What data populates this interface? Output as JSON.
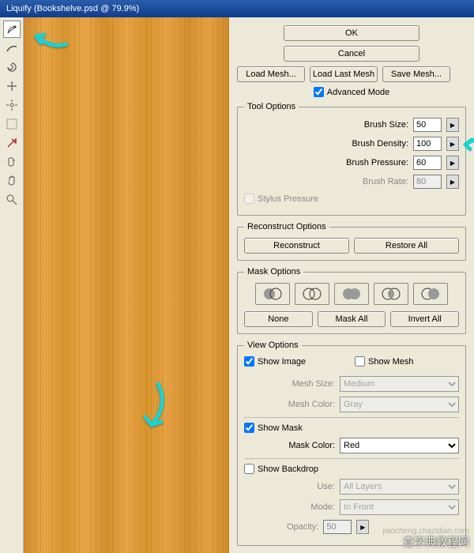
{
  "title": "Liquify (Bookshelve.psd @ 79.9%)",
  "buttons": {
    "ok": "OK",
    "cancel": "Cancel",
    "load_mesh": "Load Mesh...",
    "load_last": "Load Last Mesh",
    "save_mesh": "Save Mesh..."
  },
  "advanced_mode": "Advanced Mode",
  "tool_options": {
    "legend": "Tool Options",
    "brush_size": {
      "label": "Brush Size:",
      "value": "50"
    },
    "brush_density": {
      "label": "Brush Density:",
      "value": "100"
    },
    "brush_pressure": {
      "label": "Brush Pressure:",
      "value": "60"
    },
    "brush_rate": {
      "label": "Brush Rate:",
      "value": "80"
    },
    "stylus": "Stylus Pressure"
  },
  "reconstruct": {
    "legend": "Reconstruct Options",
    "reconstruct": "Reconstruct",
    "restore": "Restore All"
  },
  "mask": {
    "legend": "Mask Options",
    "none": "None",
    "mask_all": "Mask All",
    "invert": "Invert All"
  },
  "view": {
    "legend": "View Options",
    "show_image": "Show Image",
    "show_mesh": "Show Mesh",
    "mesh_size": {
      "label": "Mesh Size:",
      "value": "Medium"
    },
    "mesh_color": {
      "label": "Mesh Color:",
      "value": "Gray"
    },
    "show_mask": "Show Mask",
    "mask_color": {
      "label": "Mask Color:",
      "value": "Red"
    },
    "show_backdrop": "Show Backdrop",
    "use": {
      "label": "Use:",
      "value": "All Layers"
    },
    "mode": {
      "label": "Mode:",
      "value": "In Front"
    },
    "opacity": {
      "label": "Opacity:",
      "value": "50"
    }
  },
  "watermark": "查字典教程网",
  "watermark2": "jiaocheng.chazidian.com"
}
